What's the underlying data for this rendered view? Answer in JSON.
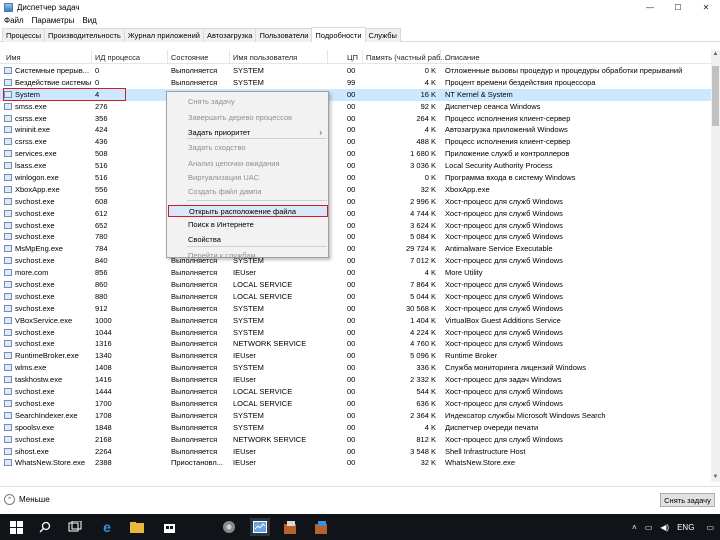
{
  "window": {
    "title": "Диспетчер задач",
    "minimize": "—",
    "maximize": "☐",
    "close": "✕"
  },
  "menu": [
    "Файл",
    "Параметры",
    "Вид"
  ],
  "tabs": [
    "Процессы",
    "Производительность",
    "Журнал приложений",
    "Автозагрузка",
    "Пользователи",
    "Подробности",
    "Службы"
  ],
  "active_tab": "Подробности",
  "columns": [
    "Имя",
    "ИД процесса",
    "Состояние",
    "Имя пользователя",
    "ЦП",
    "Память (частный раб...",
    "Описание"
  ],
  "rows": [
    [
      "Системные прерыв...",
      "0",
      "Выполняется",
      "SYSTEM",
      "00",
      "0 K",
      "Отложенные вызовы процедур и процедуры обработки прерываний"
    ],
    [
      "Бездействие системы",
      "0",
      "Выполняется",
      "SYSTEM",
      "99",
      "4 K",
      "Процент времени бездействия процессора"
    ],
    [
      "System",
      "4",
      "",
      "",
      "00",
      "16 K",
      "NT Kernel & System"
    ],
    [
      "smss.exe",
      "276",
      "",
      "",
      "00",
      "92 K",
      "Диспетчер сеанса  Windows"
    ],
    [
      "csrss.exe",
      "356",
      "",
      "",
      "00",
      "264 K",
      "Процесс исполнения клиент-сервер"
    ],
    [
      "wininit.exe",
      "424",
      "",
      "",
      "00",
      "4 K",
      "Автозагрузка приложений Windows"
    ],
    [
      "csrss.exe",
      "436",
      "",
      "",
      "00",
      "488 K",
      "Процесс исполнения клиент-сервер"
    ],
    [
      "services.exe",
      "508",
      "",
      "",
      "00",
      "1 680 K",
      "Приложение служб и контроллеров"
    ],
    [
      "lsass.exe",
      "516",
      "",
      "",
      "00",
      "3 036 K",
      "Local Security Authority Process"
    ],
    [
      "winlogon.exe",
      "516",
      "",
      "",
      "00",
      "0 K",
      "Программа входа в систему Windows"
    ],
    [
      "XboxApp.exe",
      "556",
      "",
      "",
      "00",
      "32 K",
      "XboxApp.exe"
    ],
    [
      "svchost.exe",
      "608",
      "",
      "",
      "00",
      "2 996 K",
      "Хост-процесс для служб Windows"
    ],
    [
      "svchost.exe",
      "612",
      "",
      "",
      "00",
      "4 744 K",
      "Хост-процесс для служб Windows"
    ],
    [
      "svchost.exe",
      "652",
      "",
      "",
      "00",
      "3 624 K",
      "Хост-процесс для служб Windows"
    ],
    [
      "svchost.exe",
      "780",
      "",
      "",
      "00",
      "5 084 K",
      "Хост-процесс для служб Windows"
    ],
    [
      "MsMpEng.exe",
      "784",
      "",
      "",
      "00",
      "29 724 K",
      "Antimalware Service Executable"
    ],
    [
      "svchost.exe",
      "840",
      "Выполняется",
      "SYSTEM",
      "00",
      "7 012 K",
      "Хост-процесс для служб Windows"
    ],
    [
      "more.com",
      "856",
      "Выполняется",
      "IEUser",
      "00",
      "4 K",
      "More Utility"
    ],
    [
      "svchost.exe",
      "860",
      "Выполняется",
      "LOCAL SERVICE",
      "00",
      "7 864 K",
      "Хост-процесс для служб Windows"
    ],
    [
      "svchost.exe",
      "880",
      "Выполняется",
      "LOCAL SERVICE",
      "00",
      "5 044 K",
      "Хост-процесс для служб Windows"
    ],
    [
      "svchost.exe",
      "912",
      "Выполняется",
      "SYSTEM",
      "00",
      "30 568 K",
      "Хост-процесс для служб Windows"
    ],
    [
      "VBoxService.exe",
      "1000",
      "Выполняется",
      "SYSTEM",
      "00",
      "1 404 K",
      "VirtualBox Guest Additions Service"
    ],
    [
      "svchost.exe",
      "1044",
      "Выполняется",
      "SYSTEM",
      "00",
      "4 224 K",
      "Хост-процесс для служб Windows"
    ],
    [
      "svchost.exe",
      "1316",
      "Выполняется",
      "NETWORK SERVICE",
      "00",
      "4 760 K",
      "Хост-процесс для служб Windows"
    ],
    [
      "RuntimeBroker.exe",
      "1340",
      "Выполняется",
      "IEUser",
      "00",
      "5 096 K",
      "Runtime Broker"
    ],
    [
      "wlms.exe",
      "1408",
      "Выполняется",
      "SYSTEM",
      "00",
      "336 K",
      "Служба мониторинга лицензий Windows"
    ],
    [
      "taskhostw.exe",
      "1416",
      "Выполняется",
      "IEUser",
      "00",
      "2 332 K",
      "Хост-процесс для задач Windows"
    ],
    [
      "svchost.exe",
      "1444",
      "Выполняется",
      "LOCAL SERVICE",
      "00",
      "544 K",
      "Хост-процесс для служб Windows"
    ],
    [
      "svchost.exe",
      "1700",
      "Выполняется",
      "LOCAL SERVICE",
      "00",
      "636 K",
      "Хост-процесс для служб Windows"
    ],
    [
      "SearchIndexer.exe",
      "1708",
      "Выполняется",
      "SYSTEM",
      "00",
      "2 364 K",
      "Индексатор службы Microsoft Windows Search"
    ],
    [
      "spoolsv.exe",
      "1848",
      "Выполняется",
      "SYSTEM",
      "00",
      "4 K",
      "Диспетчер очереди печати"
    ],
    [
      "svchost.exe",
      "2168",
      "Выполняется",
      "NETWORK SERVICE",
      "00",
      "812 K",
      "Хост-процесс для служб Windows"
    ],
    [
      "sihost.exe",
      "2264",
      "Выполняется",
      "IEUser",
      "00",
      "3 548 K",
      "Shell Infrastructure Host"
    ],
    [
      "WhatsNew.Store.exe",
      "2388",
      "Приостановл...",
      "IEUser",
      "00",
      "32 K",
      "WhatsNew.Store.exe"
    ]
  ],
  "context_menu": {
    "items": [
      {
        "label": "Снять задачу",
        "disabled": true
      },
      {
        "label": "Завершить дерево процессов",
        "disabled": true
      },
      {
        "label": "Задать приоритет",
        "disabled": false,
        "submenu": "›"
      },
      {
        "label": "Задать сходство",
        "disabled": true
      },
      {
        "label": "Анализ цепочки ожидания",
        "disabled": true
      },
      {
        "label": "Виртуализация UAC",
        "disabled": true
      },
      {
        "label": "Создать файл дампа",
        "disabled": true
      },
      {
        "label": "Открыть расположение файла",
        "disabled": false,
        "highlighted": true
      },
      {
        "label": "Поиск в Интернете",
        "disabled": false
      },
      {
        "label": "Свойства",
        "disabled": false
      },
      {
        "label": "Перейти к службам",
        "disabled": true
      }
    ]
  },
  "bottom": {
    "less_label": "Меньше",
    "end_task_label": "Снять задачу"
  },
  "taskbar": {
    "language": "ENG",
    "time": ""
  },
  "colors": {
    "selection": "#cce8ff",
    "highlight_border": "#d01b2a",
    "taskbar": "#101419"
  }
}
